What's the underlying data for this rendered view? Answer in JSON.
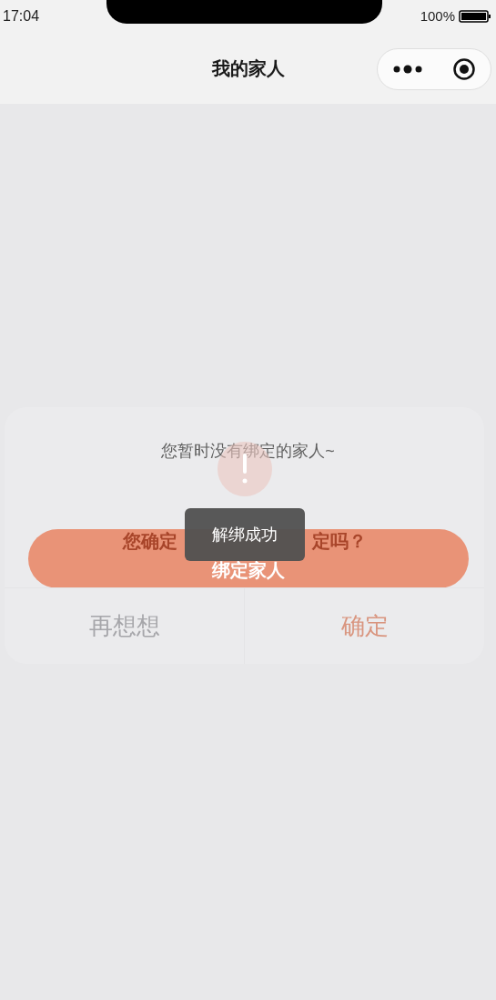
{
  "status_bar": {
    "time": "17:04",
    "battery": "100%"
  },
  "nav_bar": {
    "title": "我的家人"
  },
  "empty_state": {
    "message": "您暂时没有绑定的家人~",
    "button": "绑定家人"
  },
  "dialog": {
    "title_parts": [
      "您确定",
      "定吗？"
    ],
    "buttons": [
      {
        "label": "再想想",
        "kind": "cancel"
      },
      {
        "label": "确定",
        "kind": "confirm"
      }
    ]
  },
  "toast": {
    "message": "解绑成功"
  }
}
